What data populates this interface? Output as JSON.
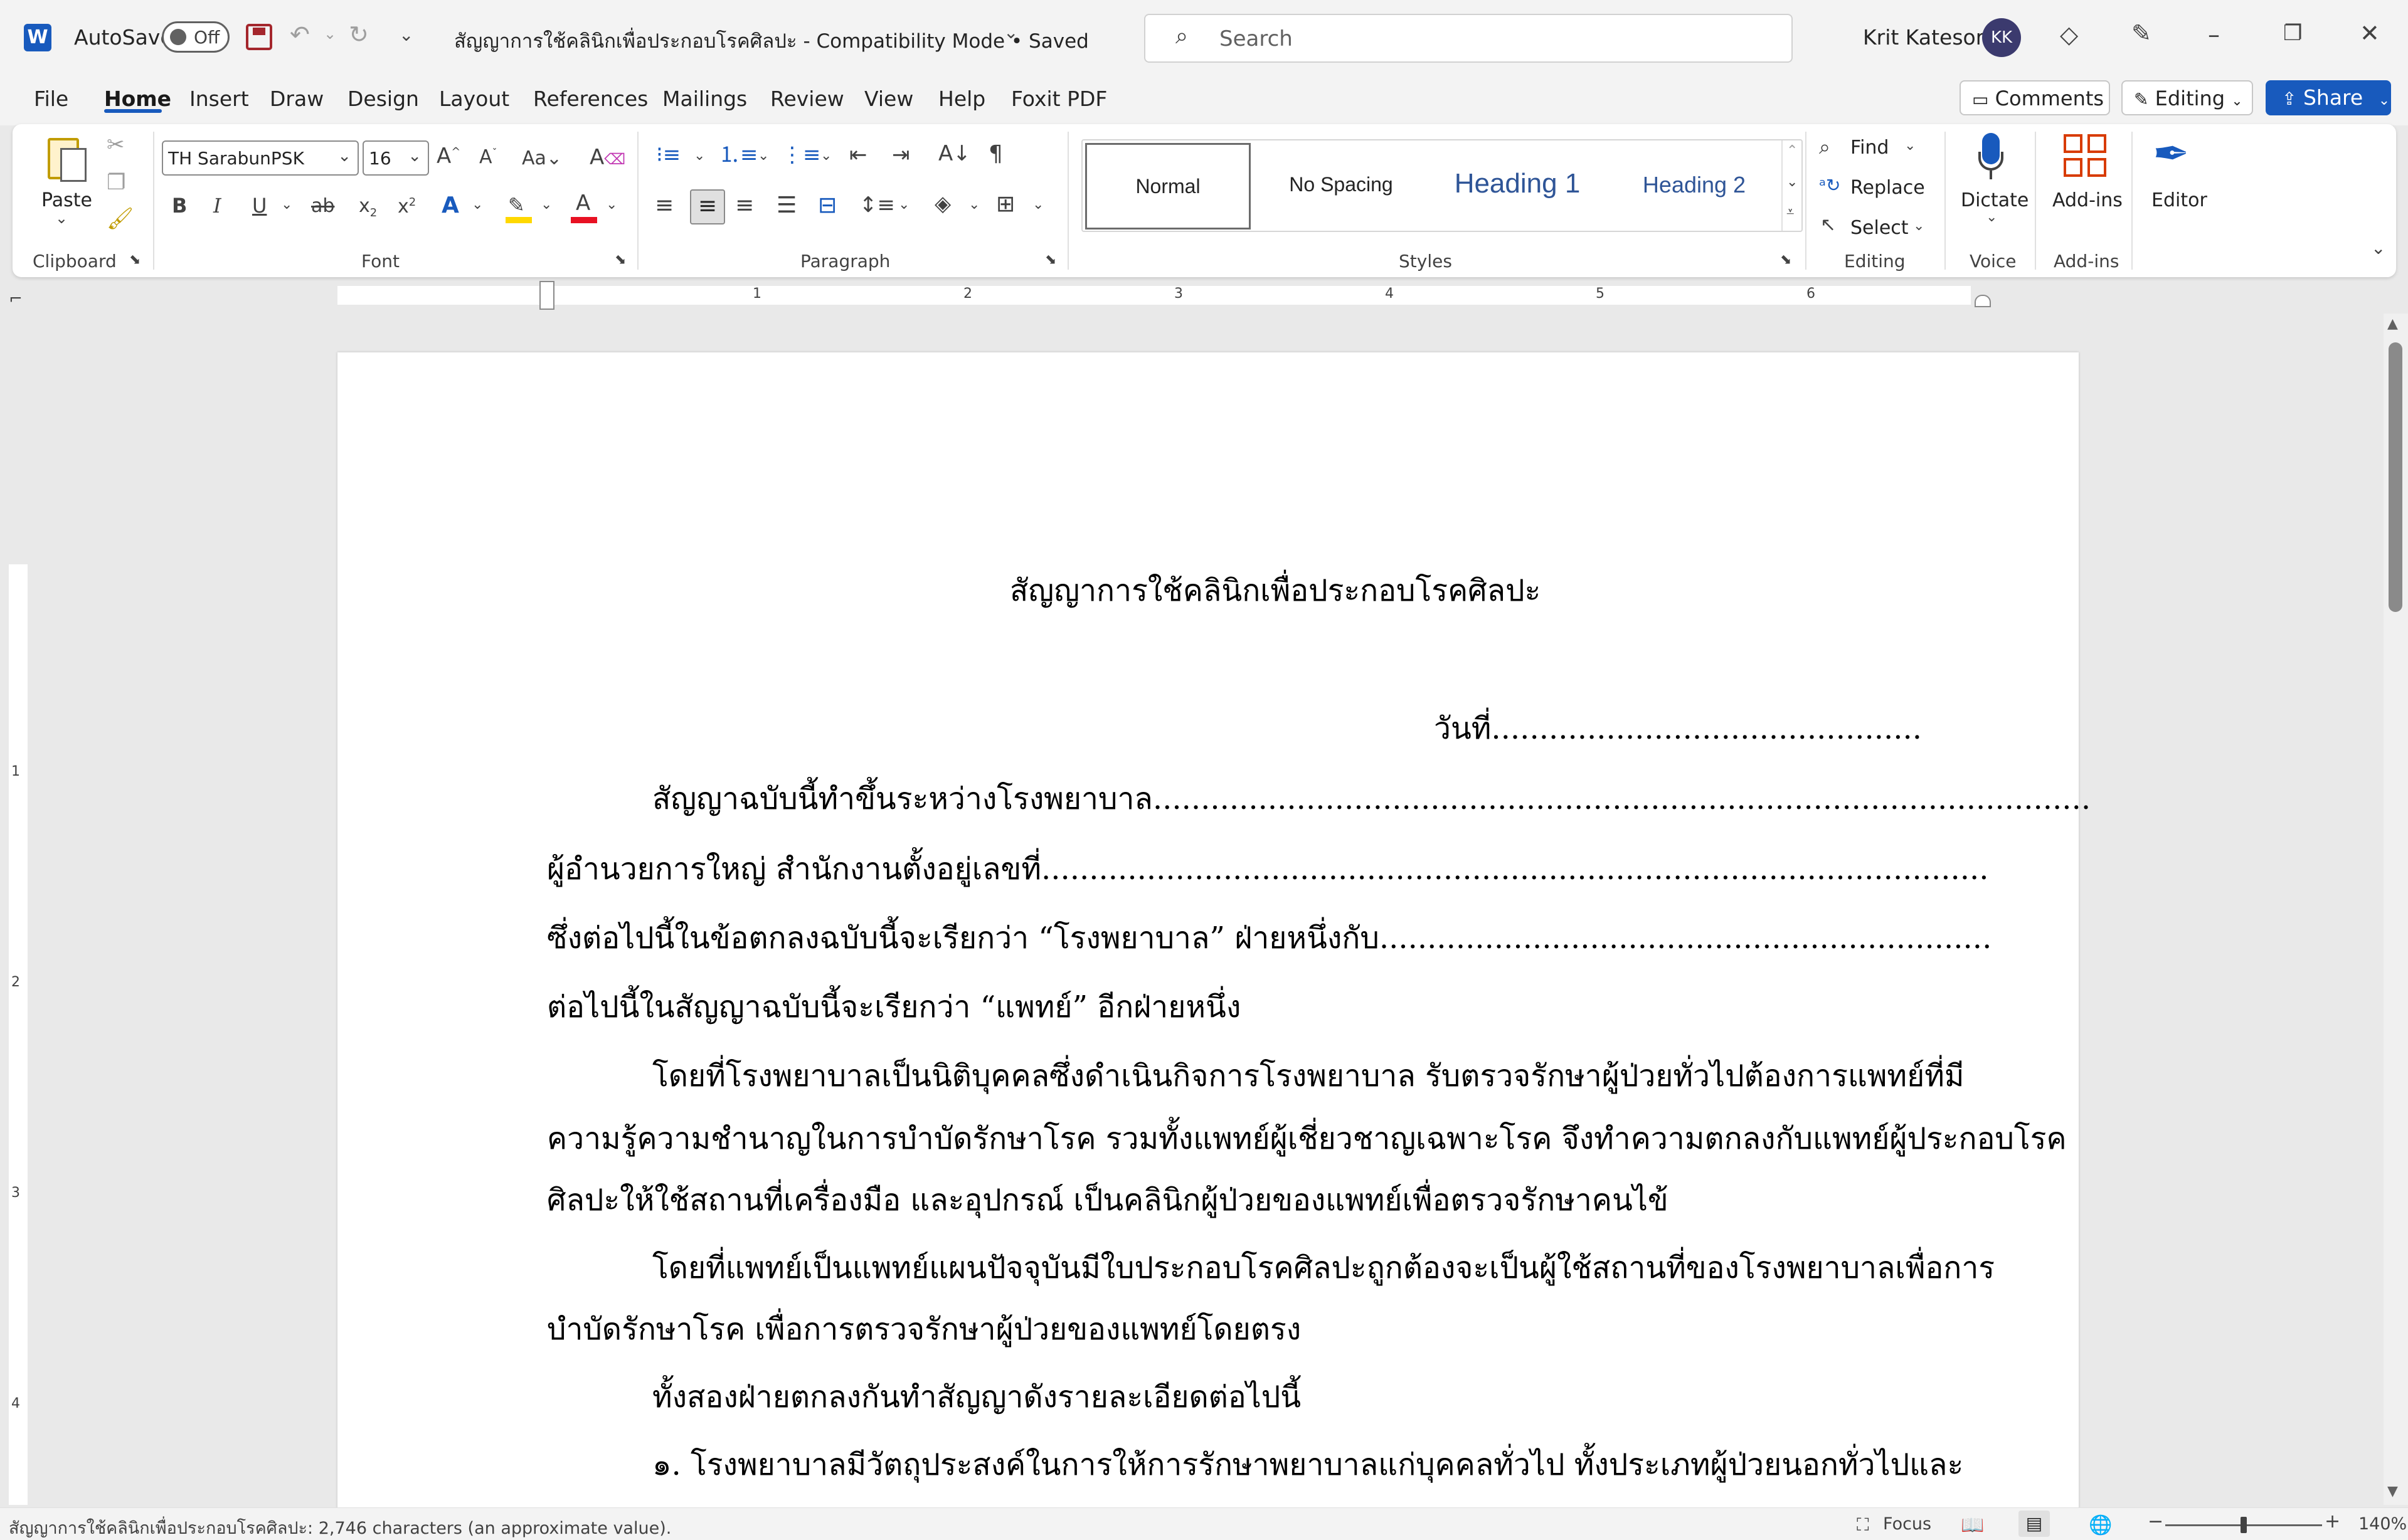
{
  "titlebar": {
    "autosave_label": "AutoSave",
    "autosave_state": "Off",
    "document_title": "สัญญาการใช้คลินิกเพื่อประกอบโรคศิลปะ  -  Compatibility Mode • Saved",
    "search_placeholder": "Search",
    "user_name": "Krit Katesorn",
    "user_initials": "KK"
  },
  "menu": {
    "items": [
      "File",
      "Home",
      "Insert",
      "Draw",
      "Design",
      "Layout",
      "References",
      "Mailings",
      "Review",
      "View",
      "Help",
      "Foxit PDF"
    ],
    "active": "Home",
    "comments_label": "Comments",
    "editing_label": "Editing",
    "share_label": "Share"
  },
  "ribbon": {
    "clipboard": {
      "paste_label": "Paste",
      "group_label": "Clipboard"
    },
    "font": {
      "font_name": "TH SarabunPSK",
      "font_size": "16",
      "group_label": "Font",
      "bold": "B",
      "italic": "I",
      "underline": "U",
      "strike": "ab",
      "subscript": "x₂",
      "superscript": "x²",
      "case": "Aa",
      "grow": "A^",
      "shrink": "Aˇ"
    },
    "paragraph": {
      "group_label": "Paragraph"
    },
    "styles": {
      "group_label": "Styles",
      "items": [
        "Normal",
        "No Spacing",
        "Heading 1",
        "Heading 2"
      ],
      "selected": "Normal"
    },
    "editing": {
      "group_label": "Editing",
      "find": "Find",
      "replace": "Replace",
      "select": "Select"
    },
    "voice": {
      "group_label": "Voice",
      "dictate": "Dictate"
    },
    "addins": {
      "group_label": "Add-ins",
      "addins": "Add-ins"
    },
    "editor": {
      "editor": "Editor"
    },
    "colors": {
      "accent": "#185abd",
      "highlight": "#ffd800",
      "font_color": "#e81123"
    }
  },
  "ruler": {
    "marks": [
      "1",
      "2",
      "3",
      "4",
      "5",
      "6"
    ],
    "vmarks": [
      "1",
      "2",
      "3",
      "4"
    ]
  },
  "document": {
    "title": "สัญญาการใช้คลินิกเพื่อประกอบโรคศิลปะ",
    "date_line": "วันที่.............................................",
    "lines": [
      "สัญญาฉบับนี้ทำขึ้นระหว่างโรงพยาบาล..................................................................................................",
      "ผู้อำนวยการใหญ่ สำนักงานตั้งอยู่เลขที่...................................................................................................",
      "ซึ่งต่อไปนี้ในข้อตกลงฉบับนี้จะเรียกว่า “โรงพยาบาล” ฝ่ายหนึ่งกับ................................................................",
      "ต่อไปนี้ในสัญญาฉบับนี้จะเรียกว่า “แพทย์” อีกฝ่ายหนึ่ง",
      "โดยที่โรงพยาบาลเป็นนิติบุคคลซึ่งดำเนินกิจการโรงพยาบาล รับตรวจรักษาผู้ป่วยทั่วไปต้องการแพทย์ที่มี",
      "ความรู้ความชำนาญในการบำบัดรักษาโรค รวมทั้งแพทย์ผู้เชี่ยวชาญเฉพาะโรค จึงทำความตกลงกับแพทย์ผู้ประกอบโรค",
      "ศิลปะให้ใช้สถานที่เครื่องมือ และอุปกรณ์ เป็นคลินิกผู้ป่วยของแพทย์เพื่อตรวจรักษาคนไข้",
      "โดยที่แพทย์เป็นแพทย์แผนปัจจุบันมีใบประกอบโรคศิลปะถูกต้องจะเป็นผู้ใช้สถานที่ของโรงพยาบาลเพื่อการ",
      "บำบัดรักษาโรค เพื่อการตรวจรักษาผู้ป่วยของแพทย์โดยตรง",
      "ทั้งสองฝ่ายตกลงกันทำสัญญาดังรายละเอียดต่อไปนี้",
      "๑.   โรงพยาบาลมีวัตถุประสงค์ในการให้การรักษาพยาบาลแก่บุคคลทั่วไป ทั้งประเภทผู้ป่วยนอกทั่วไปและ"
    ]
  },
  "statusbar": {
    "word_count": "สัญญาการใช้คลินิกเพื่อประกอบโรคศิลปะ: 2,746 characters (an approximate value).",
    "focus_label": "Focus",
    "zoom": "140%"
  }
}
